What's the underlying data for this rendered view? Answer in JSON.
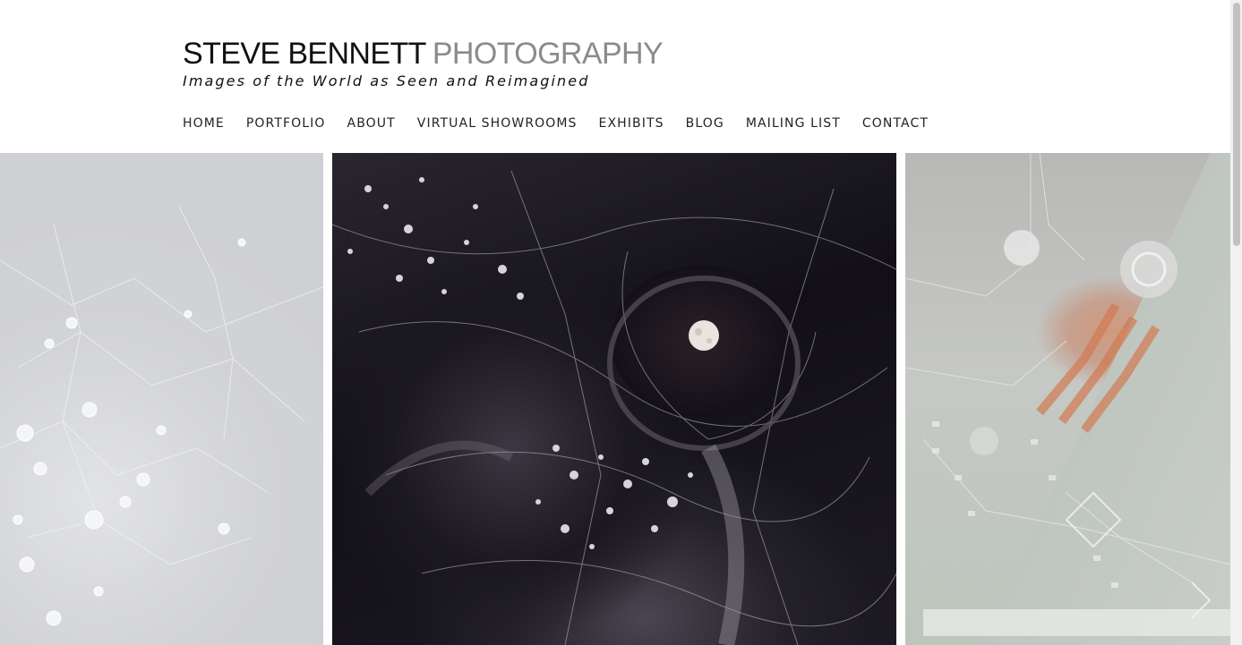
{
  "site": {
    "name": "STEVE BENNETT",
    "name_suffix": "PHOTOGRAPHY",
    "tagline": "Images of the World as Seen and Reimagined"
  },
  "nav": {
    "items": [
      {
        "label": "HOME"
      },
      {
        "label": "PORTFOLIO"
      },
      {
        "label": "ABOUT"
      },
      {
        "label": "VIRTUAL SHOWROOMS"
      },
      {
        "label": "EXHIBITS"
      },
      {
        "label": "BLOG"
      },
      {
        "label": "MAILING LIST"
      },
      {
        "label": "CONTACT"
      }
    ]
  },
  "slider": {
    "slides": [
      {
        "subject": "dew-drops-on-web",
        "state": "faded"
      },
      {
        "subject": "moon-reflection-in-dewy-web",
        "state": "active"
      },
      {
        "subject": "circuit-board",
        "state": "faded"
      }
    ]
  },
  "colors": {
    "brand_dark": "#111111",
    "brand_light": "#8b8b8b",
    "nav_text": "#222222"
  }
}
